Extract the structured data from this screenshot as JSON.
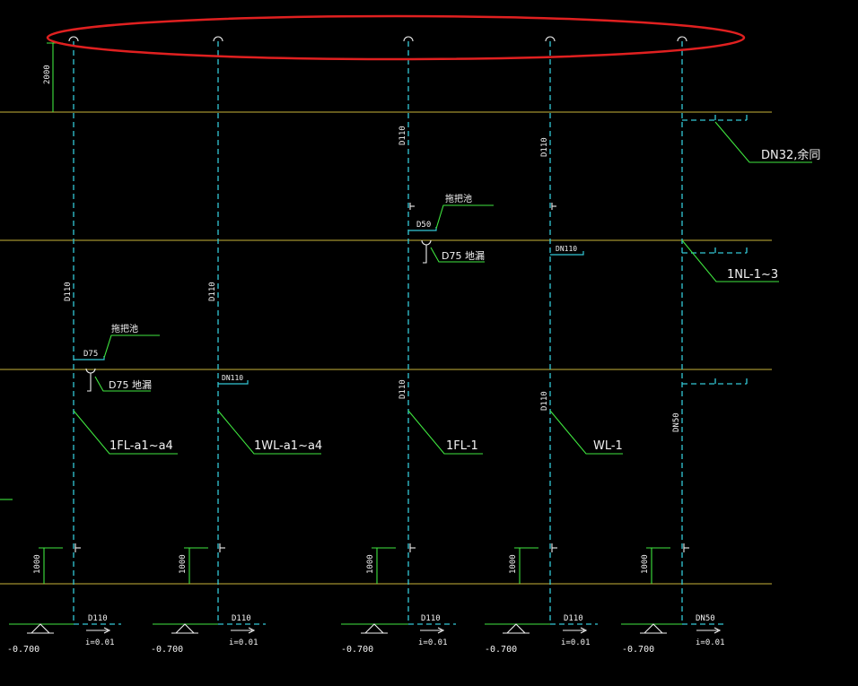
{
  "highlight": {
    "color": "#e02020"
  },
  "colors": {
    "pipe": "#33c8d6",
    "floor": "#c9b43a",
    "annotation": "#3fe63f",
    "text": "#f2f2f2",
    "background": "#000000"
  },
  "dims": {
    "top_height": "2000",
    "bottom_height": "1000"
  },
  "top_pipe_labels": {
    "p3": "D110",
    "p4": "D110"
  },
  "stacks": [
    {
      "id": "1FL-a1~a4",
      "label": "1FL-a1~a4",
      "pipe_size_mid": "D110",
      "branch_label": "D75",
      "fixture_note": "拖把池",
      "drain_note": "D75 地漏",
      "outlet_size": "D110",
      "slope": "i=0.01",
      "elevation": "-0.700"
    },
    {
      "id": "1WL-a1~a4",
      "label": "1WL-a1~a4",
      "pipe_size_mid": "D110",
      "branch_label": "DN110",
      "outlet_size": "D110",
      "slope": "i=0.01",
      "elevation": "-0.700"
    },
    {
      "id": "1FL-1",
      "label": "1FL-1",
      "pipe_size_mid": "D110",
      "branch_label": "D50",
      "fixture_note": "拖把池",
      "drain_note": "D75 地漏",
      "outlet_size": "D110",
      "slope": "i=0.01",
      "elevation": "-0.700"
    },
    {
      "id": "WL-1",
      "label": "WL-1",
      "pipe_size_mid": "D110",
      "branch_label": "DN110",
      "outlet_size": "D110",
      "slope": "i=0.01",
      "elevation": "-0.700"
    },
    {
      "id": "1NL-1~3",
      "label": "1NL-1~3",
      "pipe_size_mid": "DN50",
      "top_note": "DN32,余同",
      "outlet_size": "DN50",
      "slope": "i=0.01",
      "elevation": "-0.700"
    }
  ]
}
